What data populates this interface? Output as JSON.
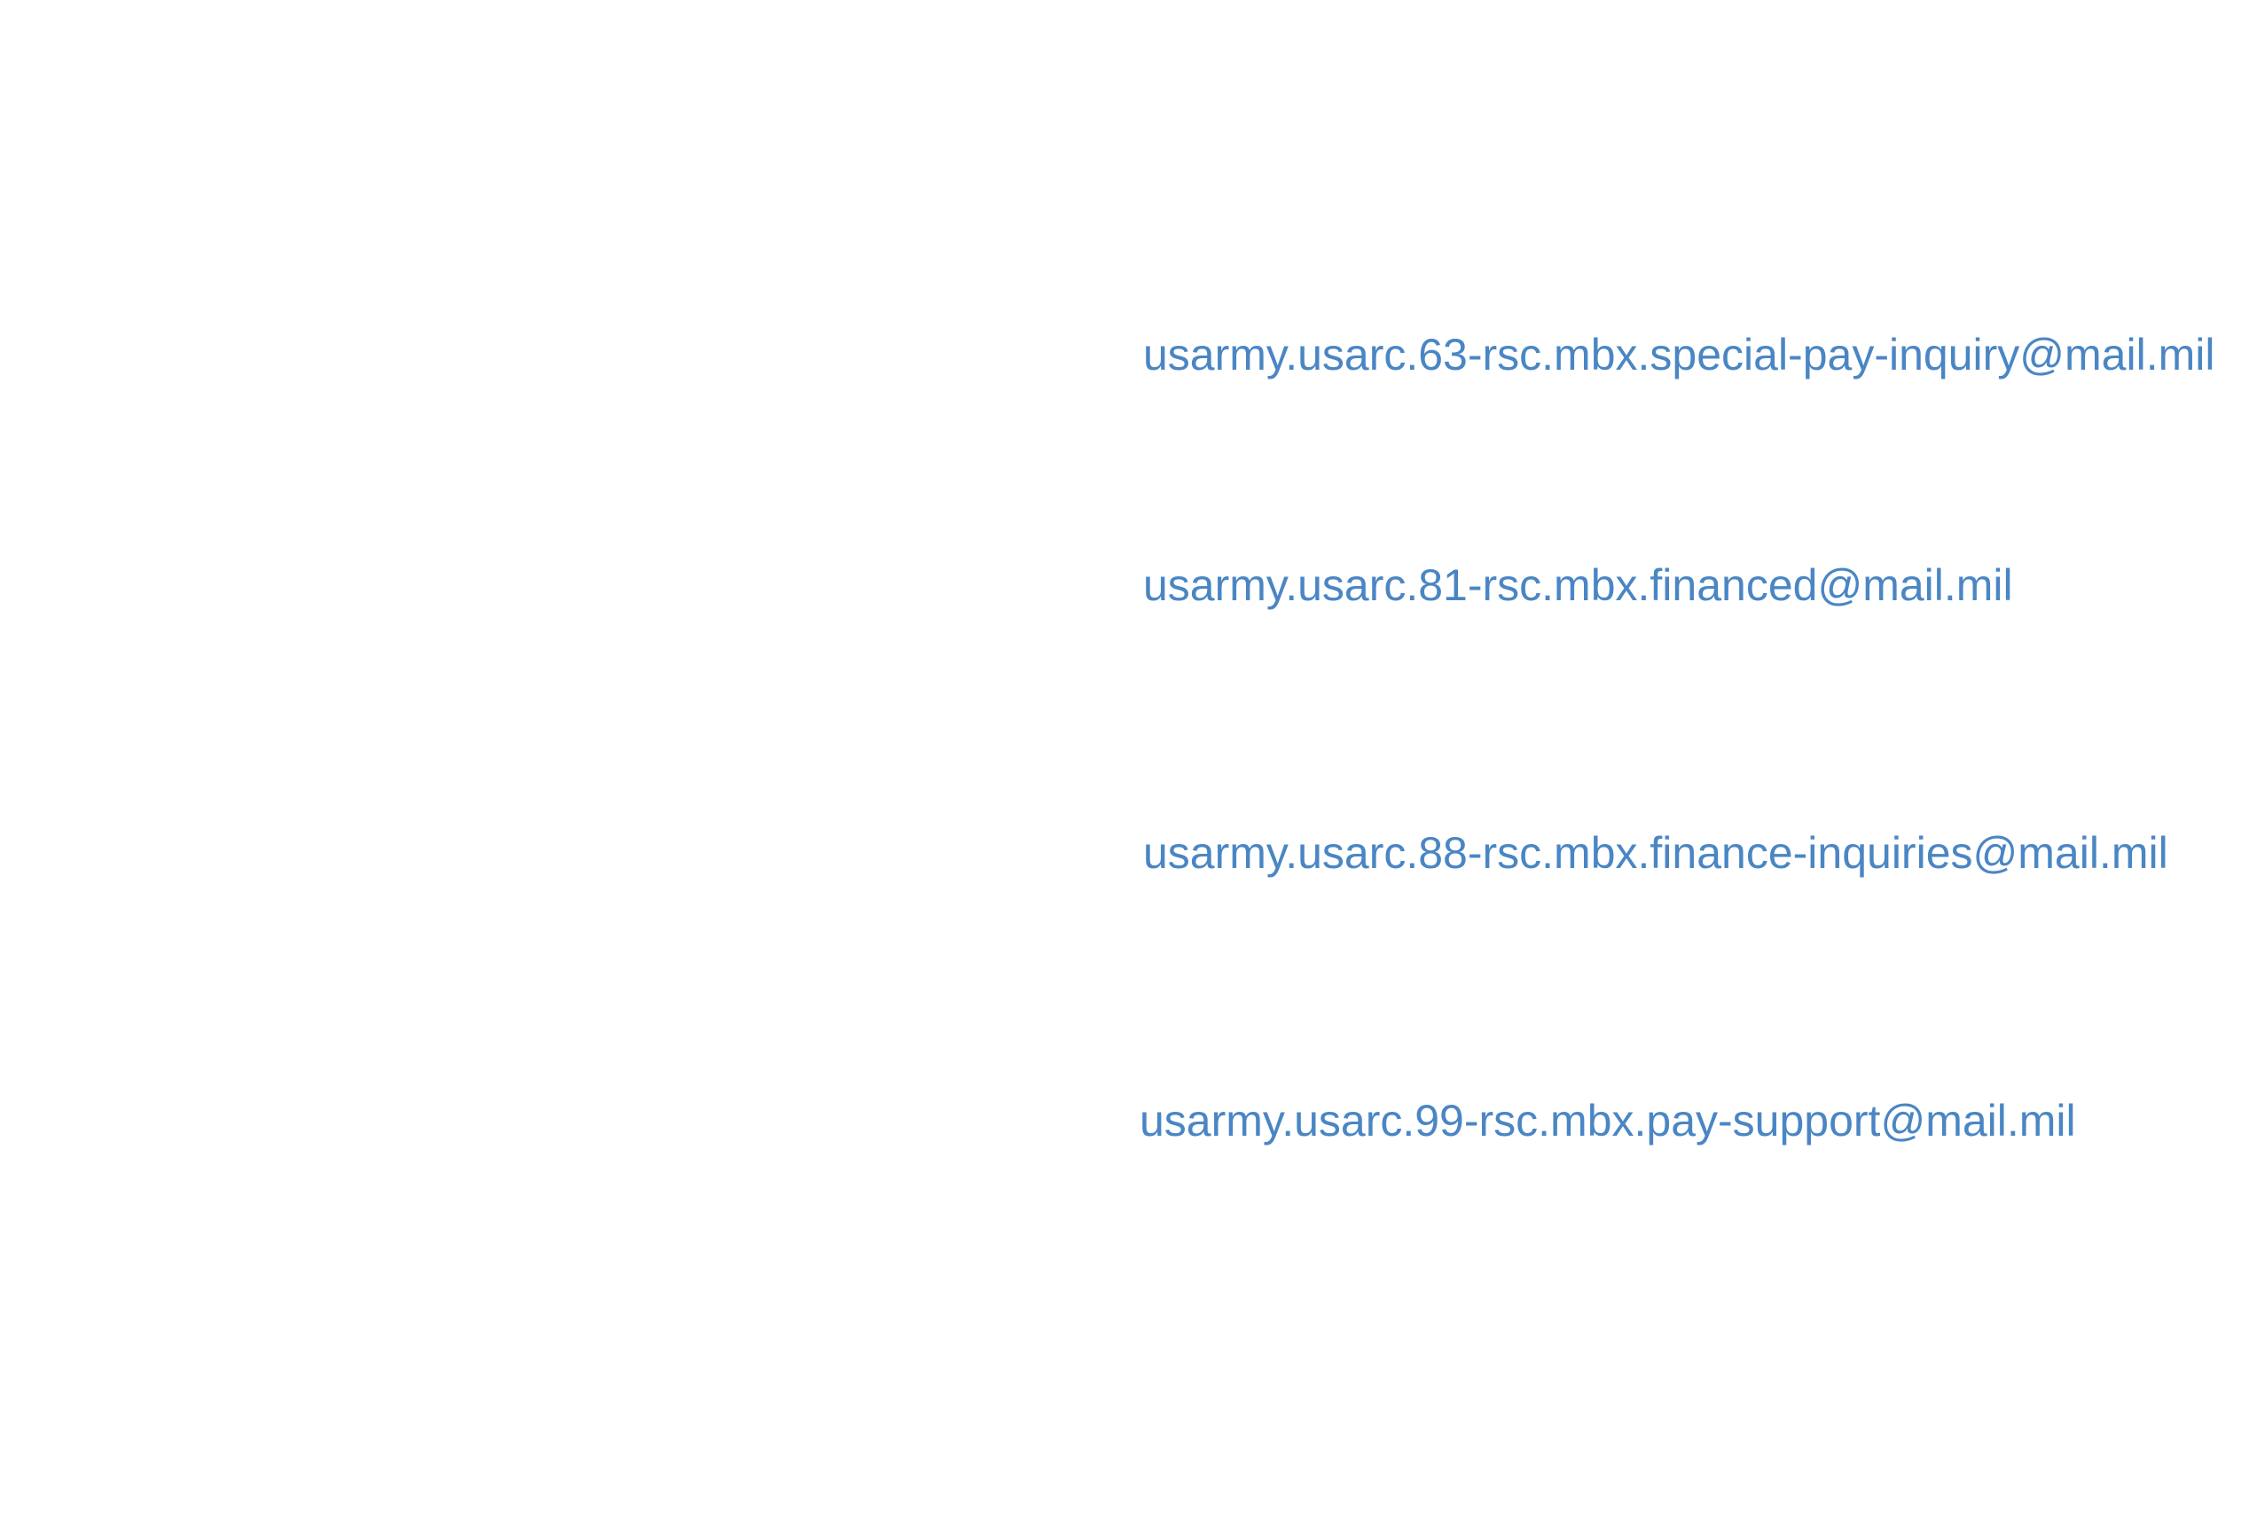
{
  "links": {
    "email_63_rsc": "usarmy.usarc.63-rsc.mbx.special-pay-inquiry@mail.mil",
    "email_81_rsc": "usarmy.usarc.81-rsc.mbx.financed@mail.mil",
    "email_88_rsc": "usarmy.usarc.88-rsc.mbx.finance-inquiries@mail.mil",
    "email_99_rsc": "usarmy.usarc.99-rsc.mbx.pay-support@mail.mil"
  },
  "colors": {
    "link": "#4a86c4",
    "background": "#ffffff"
  }
}
